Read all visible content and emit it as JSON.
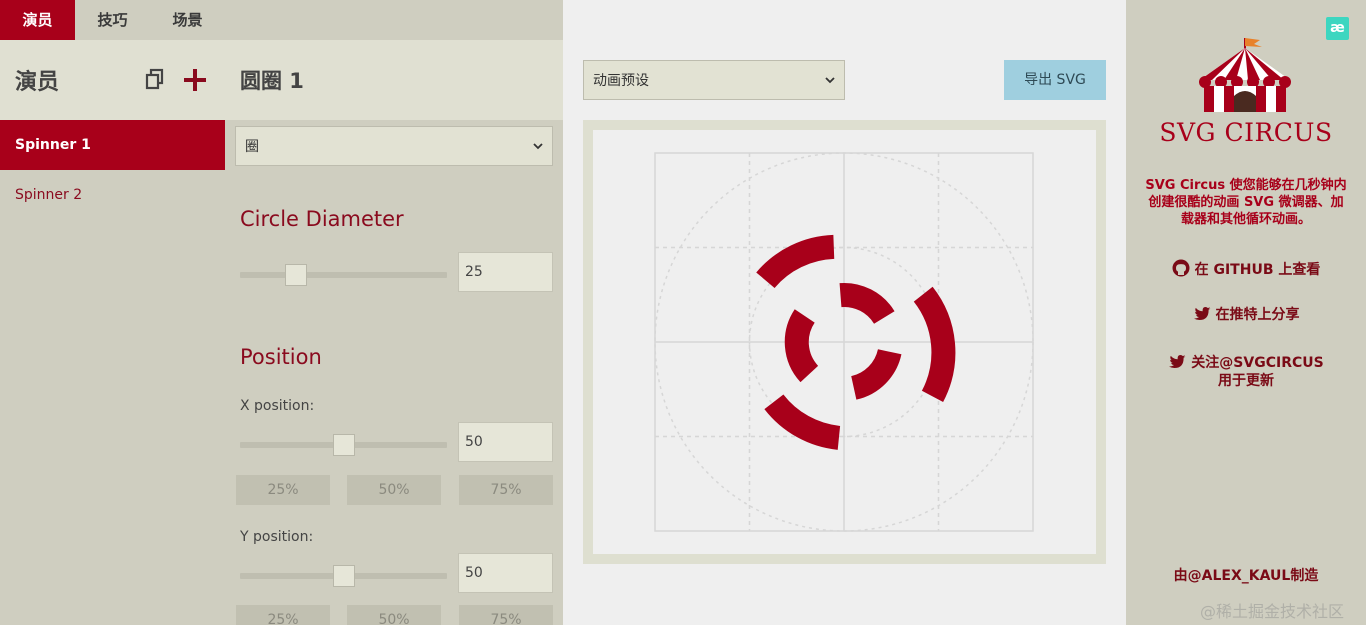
{
  "tabs": [
    {
      "label": "演员",
      "active": true
    },
    {
      "label": "技巧",
      "active": false
    },
    {
      "label": "场景",
      "active": false
    }
  ],
  "actors": {
    "title": "演员",
    "items": [
      {
        "label": "Spinner 1",
        "active": true
      },
      {
        "label": "Spinner 2",
        "active": false
      }
    ]
  },
  "props": {
    "title": "圆圈 1",
    "shape_select": "圈",
    "circle_diameter": {
      "title": "Circle Diameter",
      "value": "25",
      "slider_fraction": 0.27
    },
    "position": {
      "title": "Position",
      "x": {
        "label": "X position:",
        "value": "50",
        "slider_fraction": 0.5
      },
      "y": {
        "label": "Y position:",
        "value": "50",
        "slider_fraction": 0.5
      },
      "presets": [
        "25%",
        "50%",
        "75%"
      ]
    }
  },
  "stage": {
    "animation_select": "动画预设",
    "export_label": "导出 SVG"
  },
  "info": {
    "badge": "æ",
    "brand_name": "SVG CIRCUS",
    "description": "SVG Circus 使您能够在几秒钟内创建很酷的动画 SVG 微调器、加载器和其他循环动画。",
    "github": "在 GITHUB 上查看",
    "share": "在推特上分享",
    "follow_line1": "关注@SVGCIRCUS",
    "follow_line2": "用于更新",
    "credit": "由@ALEX_KAUL制造"
  },
  "watermark": "@稀土掘金技术社区",
  "colors": {
    "accent": "#a8001a",
    "panel": "#cfcec0",
    "panel_light": "#e0e0d2",
    "export": "#9fcfdf",
    "stage_bg": "#efefef"
  }
}
